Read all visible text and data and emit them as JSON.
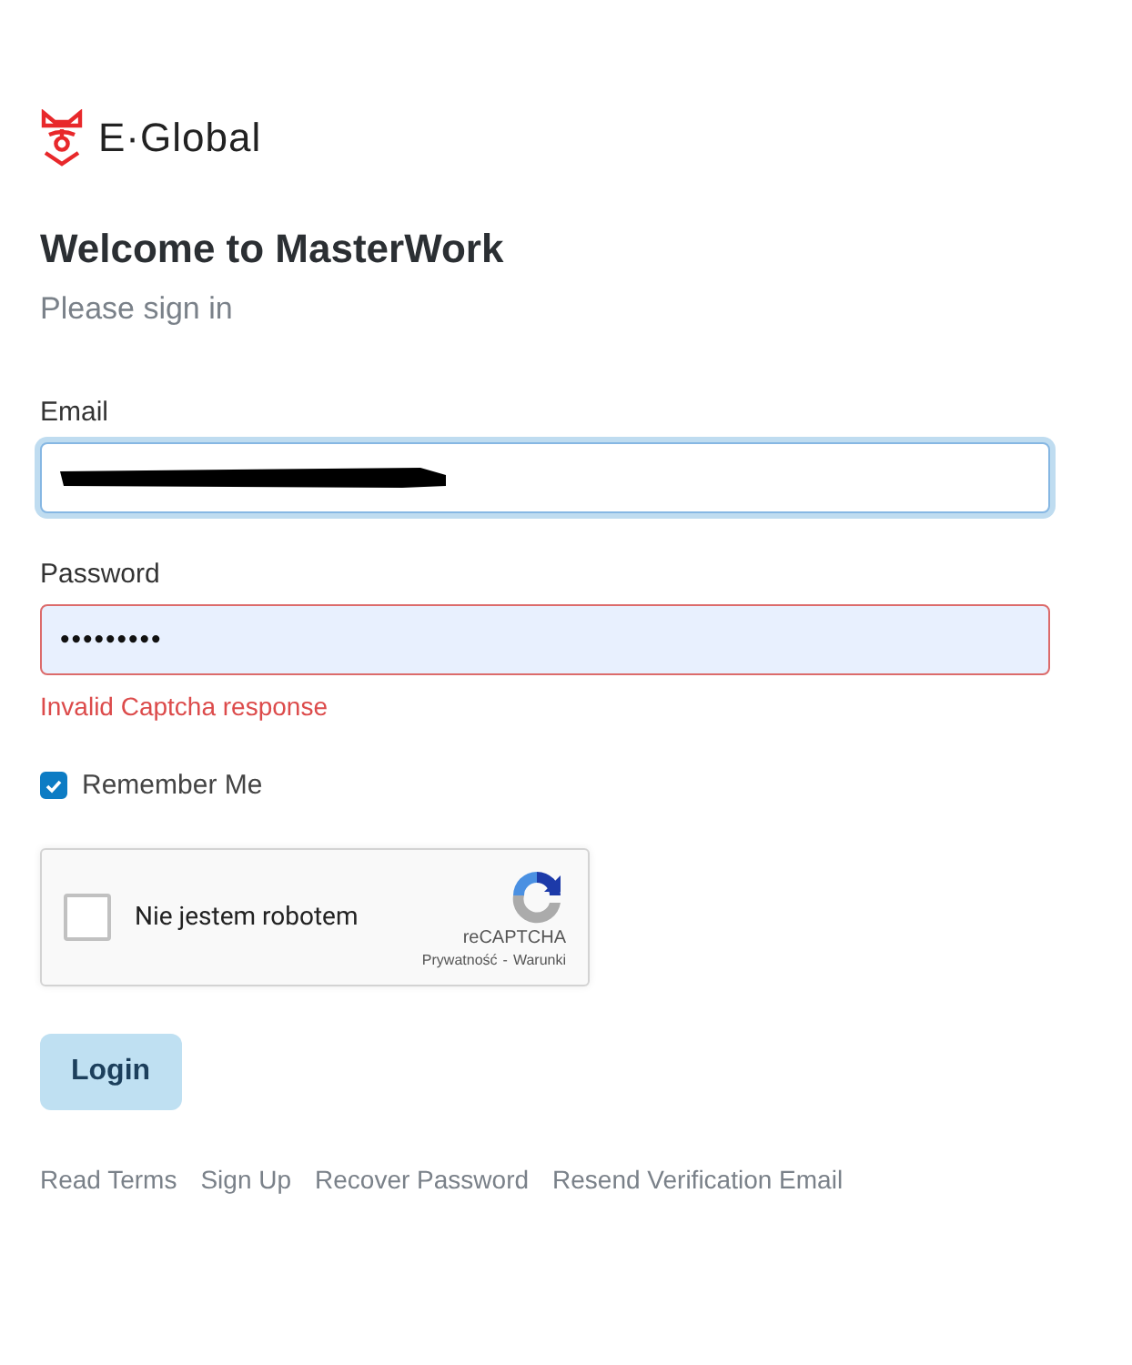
{
  "brand": {
    "name": "E·Global"
  },
  "heading": {
    "title": "Welcome to MasterWork",
    "subtitle": "Please sign in"
  },
  "email": {
    "label": "Email",
    "focused": true,
    "redacted": true
  },
  "password": {
    "label": "Password",
    "value": "•••••••••",
    "invalid": true,
    "error": "Invalid Captcha response"
  },
  "remember": {
    "label": "Remember Me",
    "checked": true
  },
  "captcha": {
    "label": "Nie jestem robotem",
    "checked": false,
    "brand": "reCAPTCHA",
    "privacy": "Prywatność",
    "separator": "-",
    "terms": "Warunki"
  },
  "login_button": {
    "label": "Login"
  },
  "links": [
    "Read Terms",
    "Sign Up",
    "Recover Password",
    "Resend Verification Email"
  ]
}
